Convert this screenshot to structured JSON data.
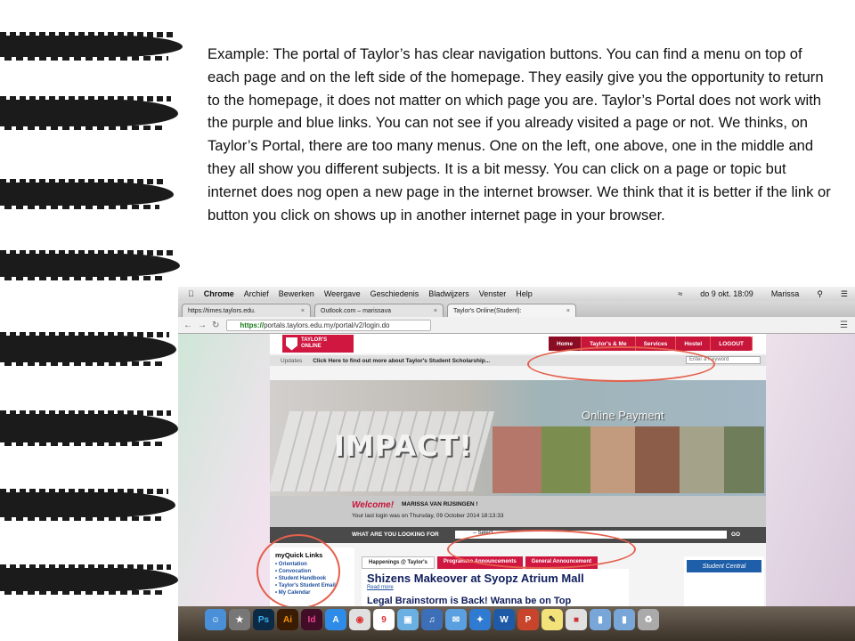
{
  "paragraph": "Example: The portal of Taylor’s has clear navigation buttons. You can find a menu on top of each page and on the left side of the homepage. They easily give you the opportunity to return to the homepage, it does not matter on which page you are. Taylor’s Portal does not work with the purple and blue links. You can not see if you already visited a page or not. We thinks, on Taylor’s Portal, there are too many menus. One on the left, one above, one in the middle and they all show you different subjects. It is a bit messy. You can click on a page or topic but internet does nog open a new page in the internet browser. We think that it is better if the link or button you click on shows up in another internet page in your browser.",
  "mac_menu": {
    "app": "Chrome",
    "items": [
      "Archief",
      "Bewerken",
      "Weergave",
      "Geschiedenis",
      "Bladwijzers",
      "Venster",
      "Help"
    ],
    "clock": "do 9 okt.  18:09",
    "user": "Marissa"
  },
  "browser": {
    "tabs": [
      {
        "label": "https://times.taylors.edu.",
        "active": false
      },
      {
        "label": "Outlook.com – marissava",
        "active": false
      },
      {
        "label": "Taylor's Online(Student): ",
        "active": true
      }
    ],
    "url_prefix": "https://",
    "url_rest": "portals.taylors.edu.my/portal/v2/login.do"
  },
  "portal": {
    "logo_line1": "TAYLOR'S",
    "logo_line2": "ONLINE",
    "nav": [
      "Home",
      "Taylor's & Me",
      "Services",
      "Hostel",
      "LOGOUT"
    ],
    "updates_label": "Updates",
    "updates_msg": "Click Here to find out more about Taylor's Student Scholarship...",
    "keyword_placeholder": "Enter a Keyword",
    "banner_impact": "IMPACT!",
    "banner_payment": "Online Payment",
    "welcome": "Welcome!",
    "user_name": "MARISSA VAN RIJSINGEN !",
    "last_login": "Your last login was on Thursday, 09 October 2014 18:13:33",
    "search_question": "WHAT ARE YOU LOOKING FOR",
    "search_select": "-- Select --",
    "search_go": "GO",
    "quick_links_title": "myQuick Links",
    "quick_links": [
      "Orientation",
      "Convocation",
      "Student Handbook",
      "Taylor's Student Email",
      "My Calendar"
    ],
    "tabs": [
      "Happenings @ Taylor's",
      "Programme Announcements",
      "General Announcement"
    ],
    "headline": "Shizens Makeover at Syopz Atrium Mall",
    "read_more": "Read more",
    "headline2": "Legal Brainstorm is Back! Wanna be on Top",
    "student_central": "Student Central"
  },
  "dock": {
    "apps": [
      "Finder",
      "Launchpad",
      "Photoshop",
      "Illustrator",
      "InDesign",
      "App Store",
      "Chrome",
      "Calendar",
      "Preview",
      "iTunes",
      "Mail",
      "Safari",
      "Word",
      "PowerPoint",
      "Notes",
      "Popcorn",
      "Folder",
      "Folder",
      "Trash"
    ]
  }
}
